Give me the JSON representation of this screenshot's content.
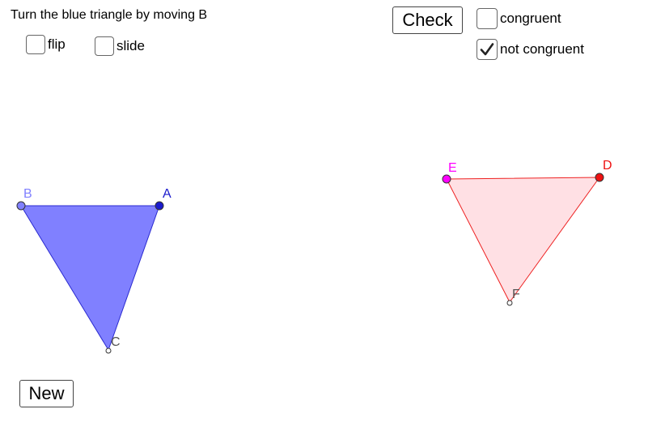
{
  "instruction": "Turn the blue triangle by moving B",
  "options": {
    "flip": {
      "label": "flip",
      "checked": false
    },
    "slide": {
      "label": "slide",
      "checked": false
    }
  },
  "answers": {
    "check_label": "Check",
    "congruent": {
      "label": "congruent",
      "checked": false
    },
    "not_congruent": {
      "label": "not congruent",
      "checked": true
    }
  },
  "new_label": "New",
  "triangle_blue": {
    "fill": "#8080ff",
    "stroke": "#2a2ad0",
    "points": {
      "A": {
        "label": "A",
        "color": "#1a1acc"
      },
      "B": {
        "label": "B",
        "color": "#8080ff"
      },
      "C": {
        "label": "C",
        "color": "#555555"
      }
    }
  },
  "triangle_red": {
    "fill": "#ffe0e4",
    "stroke": "#ee2222",
    "points": {
      "D": {
        "label": "D",
        "color": "#ee1111"
      },
      "E": {
        "label": "E",
        "color": "#ff00ff"
      },
      "F": {
        "label": "F",
        "color": "#555555"
      }
    }
  }
}
